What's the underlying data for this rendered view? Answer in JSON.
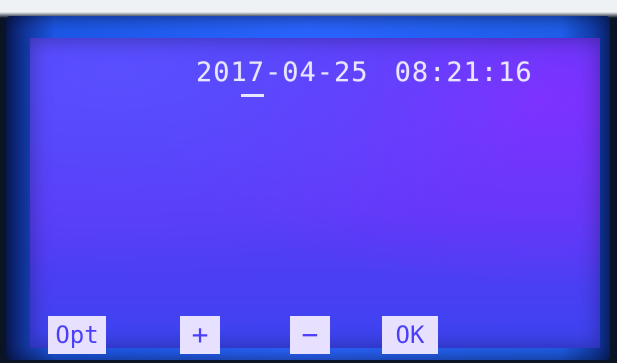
{
  "screen": {
    "date": "2017-04-25",
    "time": "08:21:16"
  },
  "softkeys": {
    "opt": "Opt",
    "plus": "+",
    "minus": "−",
    "ok": "OK"
  }
}
